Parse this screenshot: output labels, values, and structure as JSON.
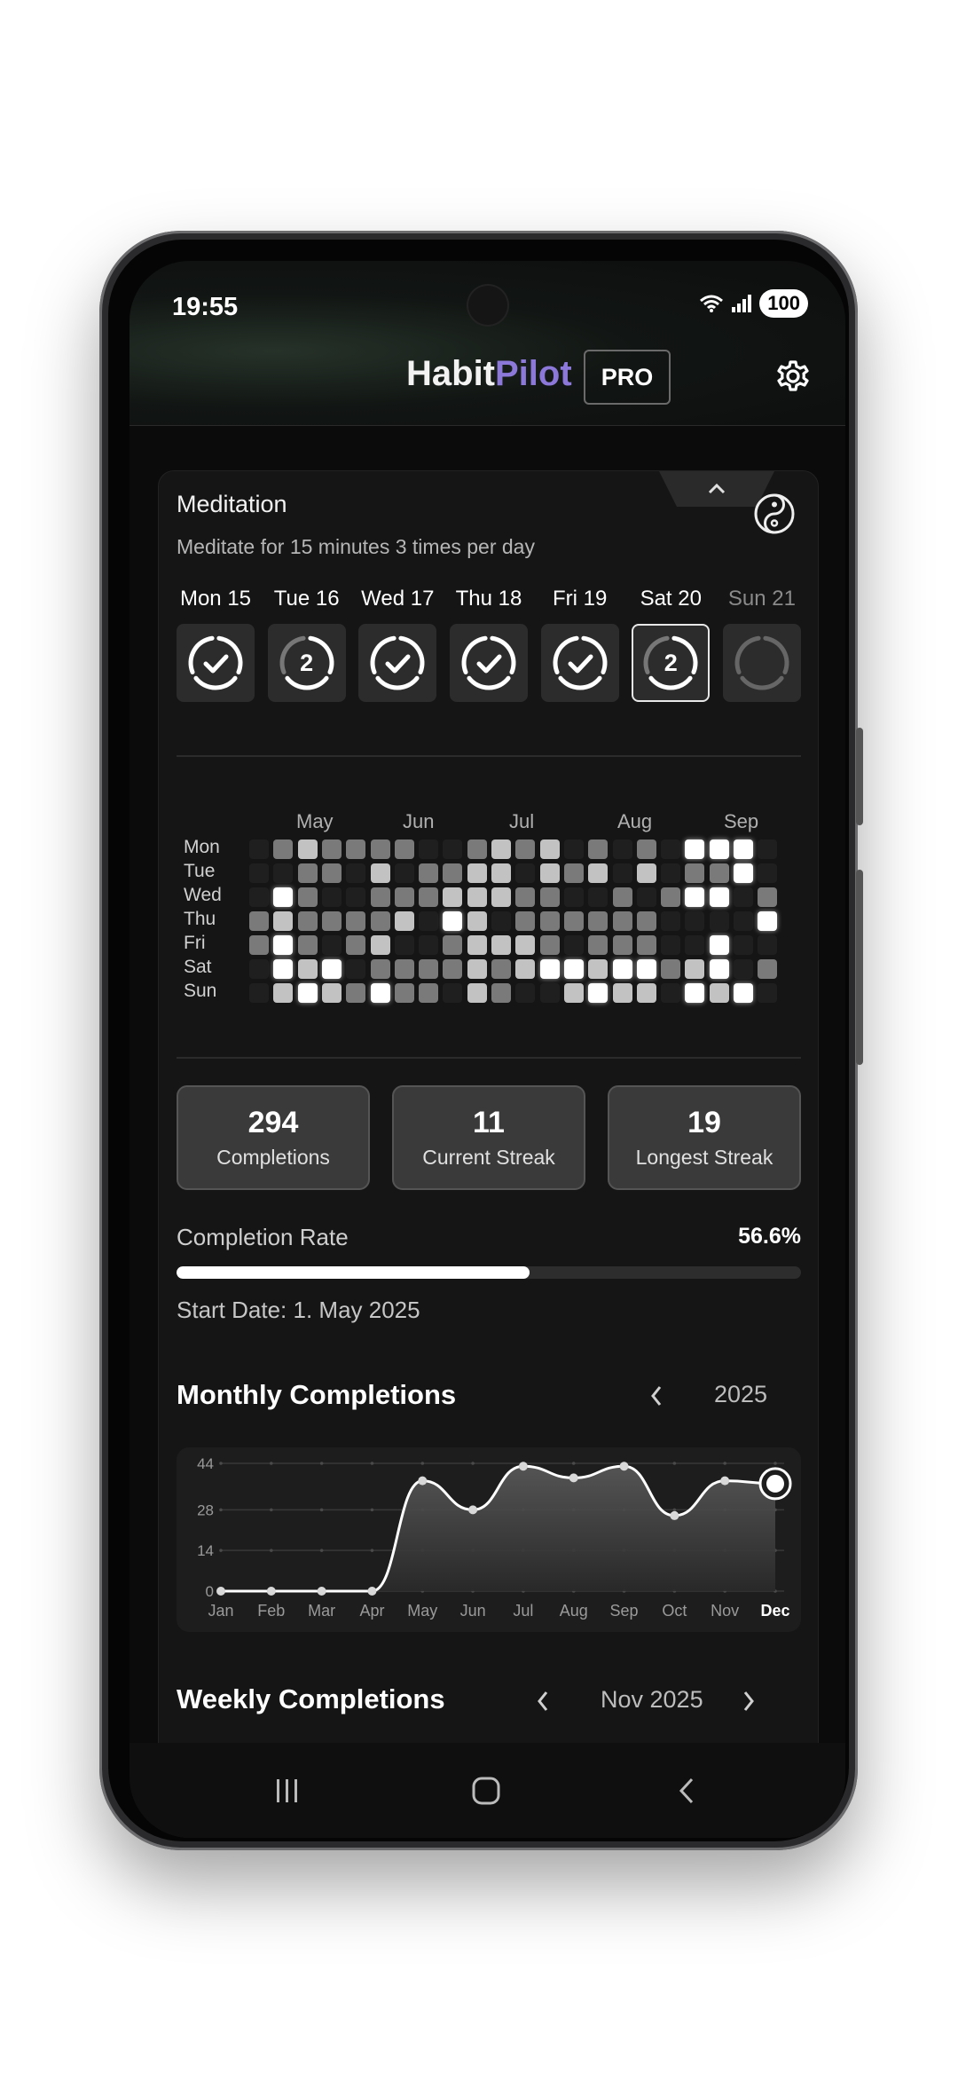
{
  "status": {
    "time": "19:55",
    "battery": "100"
  },
  "app": {
    "brand_part1": "Habit",
    "brand_part2": "Pilot",
    "badge": "PRO",
    "accent": "#8b78d8"
  },
  "habit": {
    "title": "Meditation",
    "description": "Meditate for 15 minutes 3 times per day",
    "icon": "yin-yang-icon",
    "days": [
      {
        "label": "Mon 15",
        "state": "done",
        "count": ""
      },
      {
        "label": "Tue 16",
        "state": "partial",
        "count": "2"
      },
      {
        "label": "Wed 17",
        "state": "done",
        "count": ""
      },
      {
        "label": "Thu 18",
        "state": "done",
        "count": ""
      },
      {
        "label": "Fri 19",
        "state": "done",
        "count": ""
      },
      {
        "label": "Sat 20",
        "state": "partial-selected",
        "count": "2"
      },
      {
        "label": "Sun 21",
        "state": "future",
        "count": ""
      }
    ]
  },
  "heatmap": {
    "months": [
      "May",
      "Jun",
      "Jul",
      "Aug",
      "Sep"
    ],
    "weekdays": [
      "Mon",
      "Tue",
      "Wed",
      "Thu",
      "Fri",
      "Sat",
      "Sun"
    ],
    "levels": [
      [
        0,
        2,
        3,
        2,
        2,
        2,
        2,
        0,
        0,
        2,
        3,
        2,
        3,
        0,
        2,
        0,
        2,
        0,
        4,
        4,
        4,
        0
      ],
      [
        0,
        0,
        2,
        2,
        0,
        3,
        0,
        2,
        2,
        3,
        3,
        0,
        3,
        2,
        3,
        0,
        3,
        0,
        2,
        2,
        4,
        0
      ],
      [
        0,
        4,
        2,
        0,
        0,
        2,
        2,
        2,
        3,
        3,
        3,
        2,
        2,
        0,
        0,
        2,
        0,
        2,
        4,
        4,
        0,
        2
      ],
      [
        2,
        3,
        2,
        2,
        2,
        2,
        3,
        0,
        4,
        3,
        0,
        2,
        2,
        2,
        2,
        2,
        2,
        0,
        0,
        0,
        0,
        4
      ],
      [
        2,
        4,
        2,
        0,
        2,
        3,
        0,
        0,
        2,
        3,
        3,
        3,
        2,
        0,
        2,
        2,
        2,
        0,
        0,
        4,
        0,
        0
      ],
      [
        0,
        4,
        3,
        4,
        0,
        2,
        2,
        2,
        2,
        3,
        2,
        3,
        4,
        4,
        3,
        4,
        4,
        2,
        3,
        4,
        0,
        2
      ],
      [
        0,
        3,
        4,
        3,
        2,
        4,
        2,
        2,
        0,
        3,
        2,
        0,
        0,
        3,
        4,
        3,
        3,
        0,
        4,
        3,
        4,
        0
      ]
    ]
  },
  "stats": [
    {
      "value": "294",
      "label": "Completions"
    },
    {
      "value": "11",
      "label": "Current Streak"
    },
    {
      "value": "19",
      "label": "Longest Streak"
    }
  ],
  "completion": {
    "label": "Completion Rate",
    "value_text": "56.6%",
    "fraction": 0.566
  },
  "start_date": "Start Date: 1. May 2025",
  "monthly": {
    "title": "Monthly Completions",
    "year": "2025"
  },
  "weekly": {
    "title": "Weekly Completions",
    "period": "Nov 2025"
  },
  "chart_data": {
    "type": "line",
    "title": "Monthly Completions",
    "categories": [
      "Jan",
      "Feb",
      "Mar",
      "Apr",
      "May",
      "Jun",
      "Jul",
      "Aug",
      "Sep",
      "Oct",
      "Nov",
      "Dec"
    ],
    "values": [
      0,
      0,
      0,
      0,
      38,
      28,
      43,
      39,
      43,
      26,
      38,
      37
    ],
    "yticks": [
      "0",
      "14",
      "28",
      "44"
    ],
    "ylim": [
      0,
      44
    ],
    "highlight": "Dec",
    "grid": true
  }
}
